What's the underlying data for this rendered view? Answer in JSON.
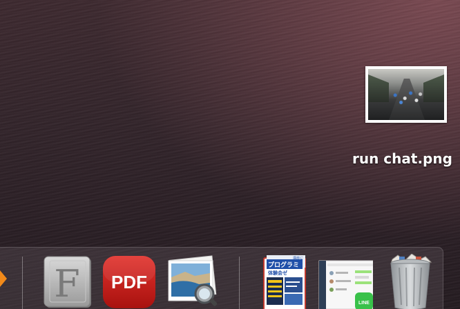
{
  "desktop": {
    "files": [
      {
        "name": "run chat.png"
      }
    ]
  },
  "dock": {
    "apps": [
      {
        "id": "partial-app",
        "icon": "orange-diamond-icon"
      },
      {
        "id": "fontbook",
        "icon": "font-book-icon",
        "glyph": "F"
      },
      {
        "id": "pdf-expert",
        "icon": "pdf-app-icon",
        "label": "PDF"
      },
      {
        "id": "preview",
        "icon": "preview-icon"
      },
      {
        "id": "document-stack",
        "icon": "document-stack-icon",
        "headline": "プログラミ",
        "subline": "講座に",
        "body": "体験会ゼ"
      },
      {
        "id": "line",
        "icon": "line-app-icon",
        "badge": "LINE"
      },
      {
        "id": "trash",
        "icon": "trash-icon"
      }
    ],
    "colors": {
      "pdf_red": "#d3201f",
      "line_green": "#39c14a",
      "fontbook_gray": "#b8b8b8"
    }
  }
}
